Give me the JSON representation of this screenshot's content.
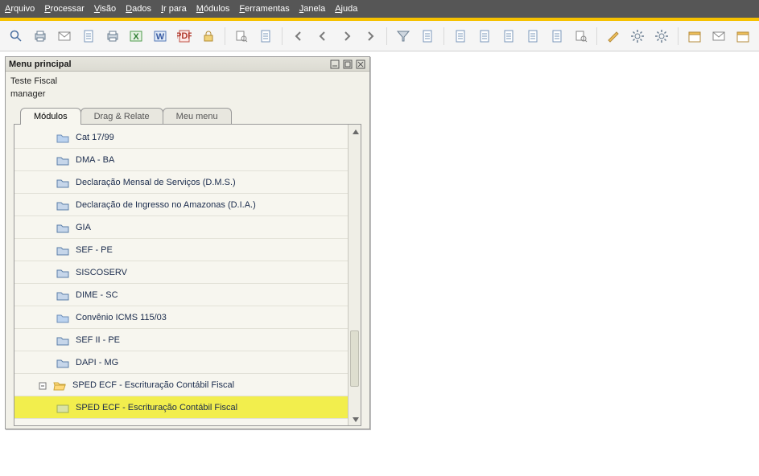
{
  "menubar": {
    "arquivo": "rquivo",
    "processar": "rocessar",
    "visao": "isão",
    "dados": "ados",
    "irpara": "r para",
    "modulos": "ódulos",
    "ferramentas": "erramentas",
    "janela": "anela",
    "ajuda": "juda"
  },
  "panel": {
    "title": "Menu principal",
    "line1": "Teste Fiscal",
    "line2": "manager"
  },
  "tabs": {
    "modulos": "Módulos",
    "dragrelate": "Drag & Relate",
    "meumenu": "Meu menu"
  },
  "tree": {
    "items": [
      {
        "label": "Cat 17/99",
        "icon": "doc"
      },
      {
        "label": "DMA - BA",
        "icon": "closed"
      },
      {
        "label": "Declaração Mensal de Serviços (D.M.S.)",
        "icon": "closed"
      },
      {
        "label": "Declaração de Ingresso no Amazonas (D.I.A.)",
        "icon": "closed"
      },
      {
        "label": "GIA",
        "icon": "closed"
      },
      {
        "label": "SEF - PE",
        "icon": "closed"
      },
      {
        "label": "SISCOSERV",
        "icon": "closed"
      },
      {
        "label": "DIME - SC",
        "icon": "closed"
      },
      {
        "label": "Convênio ICMS 115/03",
        "icon": "doc"
      },
      {
        "label": "SEF II - PE",
        "icon": "closed"
      },
      {
        "label": "DAPI - MG",
        "icon": "closed"
      }
    ],
    "open_parent": "SPED ECF - Escrituração Contábil Fiscal",
    "selected_child": "SPED ECF - Escrituração Contábil Fiscal"
  }
}
